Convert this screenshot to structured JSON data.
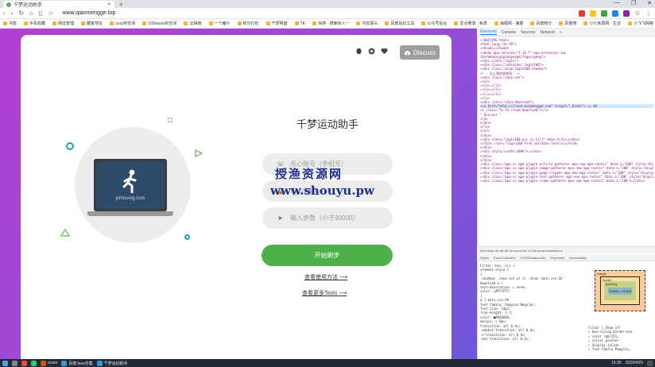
{
  "browser": {
    "tab_title": "千梦运动助手",
    "new_tab": "+",
    "window_controls": [
      "—",
      "❐",
      "✕"
    ],
    "url": "www.qianmengge.top",
    "bookmarks": [
      "书签",
      "手机收藏",
      "网址管理",
      "酷客地址",
      "cozy的空间",
      "100ourdo的空间",
      "云相册",
      "一个魔仆",
      "积分打包",
      "千梦网盘",
      "TE",
      "快搜 · 搜索快人一",
      "内容源头",
      "百度站长工具",
      "公众号后台",
      "爱合著录 · 免费",
      "海报网 · 海报",
      "百度统计",
      "百度搜",
      "小六免费网 · 生活",
      "小飞飞网络 · 问答"
    ]
  },
  "page": {
    "discuss_label": "Discuss",
    "title": "千梦运动助手",
    "logo_caption": "yimouing.com",
    "phone_placeholder": "乐心账号（手机号）",
    "password_placeholder": "乐心密码",
    "steps_placeholder": "输入步数（小于30000）",
    "start_button": "开始刷步",
    "link_usage": "查看使用方法 ⟶",
    "link_tools": "查看更多Tools ⟶",
    "watermark_cn": "授渔资源网",
    "watermark_url": "www.shouyu.pw"
  },
  "devtools": {
    "tabs": [
      "Elements",
      "Console",
      "Sources",
      "Network",
      "»"
    ],
    "active_tab": "Elements",
    "lines": [
      "<!DOCTYPE html>",
      "<html lang=\"zh-CN\">",
      "▸<head>…</head>",
      "▾<body mpa-version=\"7.16.7\" mpa-extension-id=",
      "  ibefaeehajgcpooopoegkifhgecigeeg\">",
      "  ▾<div class=\"login\">",
      "    ▾<div class=\"container login100\">",
      "      ▾<div class=\"wrap-login100 shadow\">",
      "        <!-- 右上角信息按钮 -->",
      "        ▾<div class=\"shua-set\">",
      "          ▾<ul>",
      "            ▸<li>…</li>",
      "            ▸<li>…</li>",
      "            ▸<li>…</li>",
      "            ▾<li>",
      "              ▾<div class=\"shua-download\">",
      "                ▾<a href=\"http://cloud.qianmengge.com\" target=\"_blank\"> == $0",
      "                   <i class=\"fa fa-cloud-download\"></i>",
      "                   \" Discuss \"",
      "                 </a>",
      "               </div>",
      "             </li>",
      "           </ul>",
      "         </div>",
      "        ▸<div class=\"login100-pic js-tilt\" data-tilt>…</div>",
      "        ▸<form class=\"login100-form validate-form\">…</form>",
      "       </div>",
      "      ▸<div style=\"width:100%\">…</div>",
      "     </div>",
      "    </div>",
      "  ▸<div class=\"mpa-sc mpa-plugin-article-gatherer mpa-new mpa-rootsc\" data-z=\"100\" style=\"display: block;\" id=\"mpa-rootsc-article-gatherer\">…</div>",
      "  ▸<div class=\"mpa-sc mpa-plugin-image-gatherer mpa-new mpa-rootsc\" data-z=\"100\" style=\"display: block;\" id=\"mpa-rootsc-image-gatherer\">…</div>",
      "  ▸<div class=\"mpa-sc mpa-plugin-page-clipper mpa-new mpa-rootsc\" data-z=\"100\" style=\"display: block;\" id=\"mpa-rootsc-page-clipper\">…</div>",
      "  ▸<div class=\"mpa-sc mpa-plugin-text-gatherer mpa-new mpa-rootsc\" data-z=\"100\" style=\"display: block;\" id=\"mpa-rootsc-text-gatherer\">…</div>",
      "  ▸<div class=\"mpa-sc mpa-plugin-video-gatherer mpa-new mpa-rootsc\" data-z=\"100\">…</div>"
    ],
    "breadcrumbs": "html  body  div  div  div  div.shua-set  ul  li  div.shua-download  a",
    "subtabs": [
      "Styles",
      "Event Listeners",
      "DOM Breakpoints",
      "Properties",
      "Accessibility"
    ],
    "styles": [
      "Filter                 :hov  .cls  +",
      "element.style {",
      "}",
      ".shadows .shua-set ul li .shua-    main.css:32",
      "download a {",
      "  text-decoration: ▸ none;",
      "  color: □#FFFFFF;",
      "}",
      "a {                               main.css:49",
      "  font-family: Poppins-Regular;",
      "  font-size: 14px;",
      "  line-height: 1.7;",
      "  color: ■#666666;",
      "  margin: ▸ 0px;",
      "  transition: all 0.4s;",
      "  -webkit-transition: all 0.4s;",
      "  -o-transition: all 0.4s;",
      "  -moz-transition: all 0.4s;"
    ],
    "box_model": {
      "margin": "margin",
      "border": "border",
      "padding": "padding",
      "content": "79.656 × 23.812"
    },
    "computed": [
      "Filter         □ Show all",
      "▸ box-sizing   border-box",
      "▸ color        rgb(255…",
      "▸ cursor       pointer",
      "▸ display      inline",
      "▸ font-family  Poppins…"
    ]
  },
  "taskbar": {
    "items": [
      "ocam",
      "百度Java全集",
      "千梦运动助手"
    ],
    "time": "15:35",
    "date": "2020/4/25"
  },
  "colors": {
    "accent_green": "#4eb04a",
    "gradient_start": "#b13fd3",
    "gradient_end": "#6e56d8",
    "deco_teal": "#1aa5a8"
  }
}
